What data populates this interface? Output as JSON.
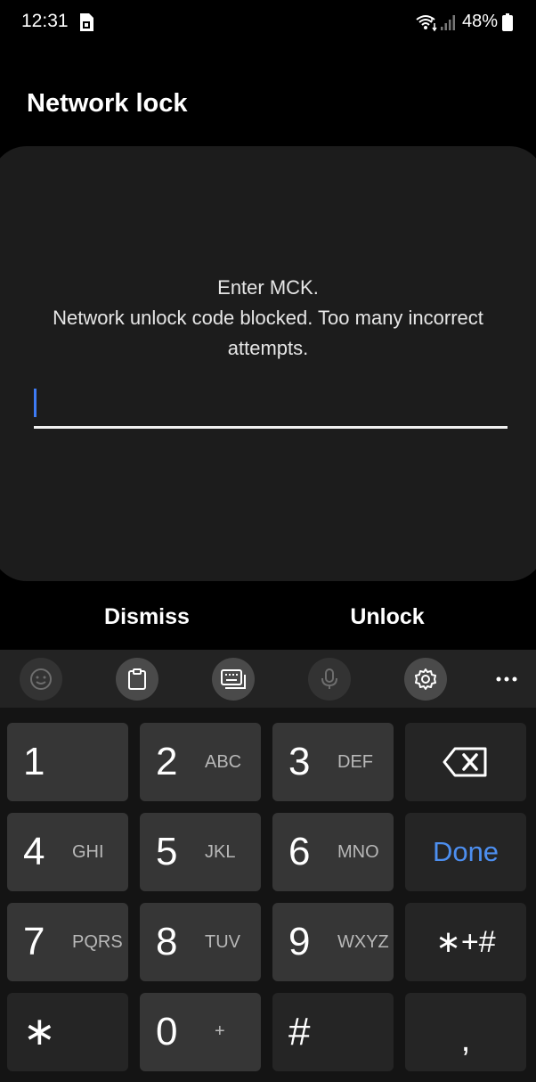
{
  "status_bar": {
    "time": "12:31",
    "battery": "48%",
    "icons": [
      "sim-card-icon",
      "wifi-icon",
      "signal-icon",
      "battery-icon"
    ]
  },
  "title": "Network lock",
  "dialog": {
    "line1": "Enter MCK.",
    "line2": "Network unlock code blocked. Too many incorrect",
    "line3": "attempts.",
    "input_value": ""
  },
  "actions": {
    "dismiss": "Dismiss",
    "unlock": "Unlock"
  },
  "toolbar": {
    "icons": [
      "emoji-icon",
      "clipboard-icon",
      "keyboard-icon",
      "microphone-icon",
      "settings-icon",
      "more-options-icon"
    ]
  },
  "keys": {
    "k1": {
      "num": "1",
      "letters": ""
    },
    "k2": {
      "num": "2",
      "letters": "ABC"
    },
    "k3": {
      "num": "3",
      "letters": "DEF"
    },
    "k4": {
      "num": "4",
      "letters": "GHI"
    },
    "k5": {
      "num": "5",
      "letters": "JKL"
    },
    "k6": {
      "num": "6",
      "letters": "MNO"
    },
    "k7": {
      "num": "7",
      "letters": "PQRS"
    },
    "k8": {
      "num": "8",
      "letters": "TUV"
    },
    "k9": {
      "num": "9",
      "letters": "WXYZ"
    },
    "k0": {
      "num": "0",
      "letters": "+"
    },
    "star": "∗",
    "hash": "#",
    "done": "Done",
    "symbols": "∗+#",
    "comma": ","
  },
  "colors": {
    "accent": "#4d8ff0",
    "card": "#1c1c1c",
    "key": "#363636",
    "key_dark": "#252525"
  }
}
